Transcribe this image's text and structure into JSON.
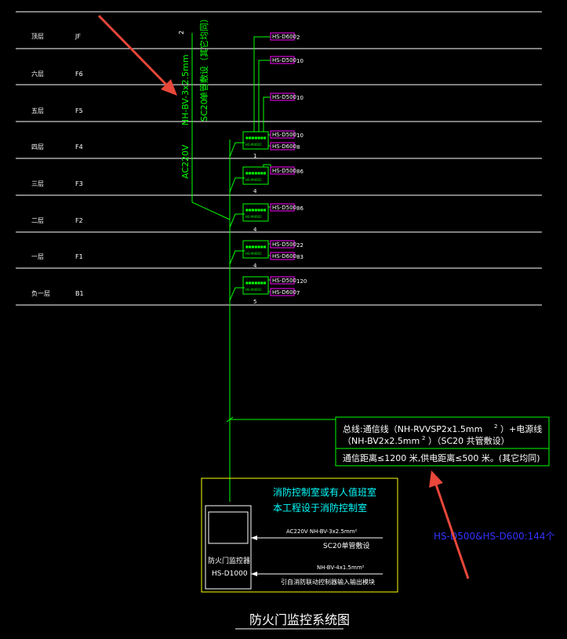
{
  "floors": [
    {
      "name": "顶层",
      "code": "JF"
    },
    {
      "name": "六层",
      "code": "F6"
    },
    {
      "name": "五层",
      "code": "F5"
    },
    {
      "name": "四层",
      "code": "F4"
    },
    {
      "name": "三层",
      "code": "F3"
    },
    {
      "name": "二层",
      "code": "F2"
    },
    {
      "name": "一层",
      "code": "F1"
    },
    {
      "name": "负一层",
      "code": "B1"
    }
  ],
  "riser": {
    "ac_label": "AC220V",
    "cable_label": "NH-BV-3x2.5mm",
    "conduit_label": "SC20",
    "laying_label": "单管敷设（其它均同）",
    "top_mark": "2"
  },
  "modules": [
    {
      "count": "1",
      "devices": [
        {
          "label": "HS-D600",
          "qty": "2"
        },
        {
          "label": "HS-D500",
          "qty": "10"
        },
        {
          "label": "HS-D500",
          "qty": "10"
        },
        {
          "label": "HS-D500",
          "qty": "10"
        },
        {
          "label": "HS-D600",
          "qty": "8"
        }
      ]
    },
    {
      "count": "4",
      "devices": [
        {
          "label": "HS-D500",
          "qty": "86"
        }
      ]
    },
    {
      "count": "4",
      "devices": [
        {
          "label": "HS-D500",
          "qty": "86"
        }
      ]
    },
    {
      "count": "4",
      "devices": [
        {
          "label": "HS-D500",
          "qty": "22"
        },
        {
          "label": "HS-D600",
          "qty": "83"
        }
      ]
    },
    {
      "count": "5",
      "devices": [
        {
          "label": "HS-D500",
          "qty": "120"
        },
        {
          "label": "HS-D600",
          "qty": "7"
        }
      ]
    }
  ],
  "module_text": {
    "top": "■■■■■■■",
    "bottom": "HS-M4002"
  },
  "bus_box": {
    "line1a": "总线:通信线（NH-RVVSP2x1.5mm",
    "line1b": "）+电源线",
    "line2a": "（NH-BV2x2.5mm",
    "line2b": "）（SC20  共管敷设）",
    "sup": "2",
    "line3": "通信距离≤1200  米,供电距离≤500  米。(其它均同)"
  },
  "control_room": {
    "title1": "消防控制室或有人值班室",
    "title2": "本工程设于消防控制室",
    "panel_name": "防火门监控器",
    "panel_model": "HS-D1000",
    "feed1": "AC220V NH-BV-3x2.5mm²",
    "feed2": "SC20单管敷设",
    "feed3": "NH-BV-4x1.5mm²",
    "feed4": "引自消防联动控制器输入输出模块"
  },
  "annotation": "HS-D500&HS-D600:144个",
  "diagram_title": "防火门监控系统图",
  "colors": {
    "green": "#00ff00",
    "white": "#ffffff",
    "magenta": "#ff00ff",
    "yellow": "#ffff00",
    "cyan": "#00ffff",
    "blue": "#3333ff",
    "red": "#e8473a"
  }
}
